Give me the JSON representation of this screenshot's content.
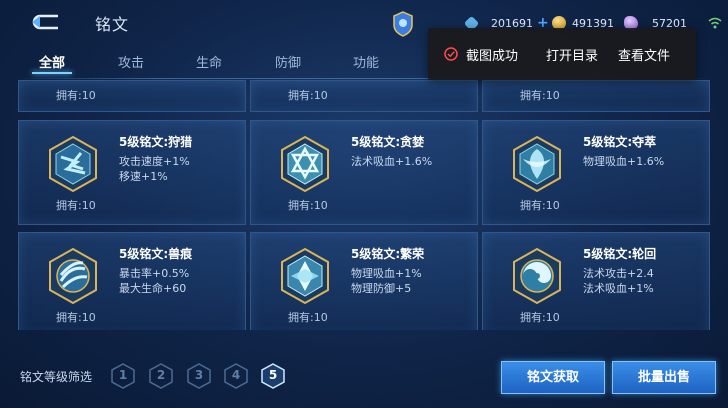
{
  "header": {
    "title": "铭文",
    "currencies": [
      {
        "icon": "coupon-gem-icon",
        "value": "201691",
        "color": "#5fb3e8"
      },
      {
        "icon": "gold-coin-icon",
        "value": "491391",
        "color": "#e0b24a"
      },
      {
        "icon": "purple-crystal-icon",
        "value": "57201",
        "color": "#b68cf0"
      }
    ]
  },
  "tabs": [
    "全部",
    "攻击",
    "生命",
    "防御",
    "功能"
  ],
  "active_tab": "全部",
  "toast": {
    "message": "截图成功",
    "open_dir": "打开目录",
    "view_file": "查看文件"
  },
  "cards_top": [
    {
      "owned": "拥有:10"
    },
    {
      "owned": "拥有:10"
    },
    {
      "owned": "拥有:10"
    }
  ],
  "cards": [
    {
      "name": "5级铭文:狩猎",
      "attr1": "攻击速度+1%",
      "attr2": "移速+1%",
      "owned": "拥有:10",
      "icon": "hunt-emblem-icon",
      "color": "#3fb6d8"
    },
    {
      "name": "5级铭文:贪婪",
      "attr1": "法术吸血+1.6%",
      "attr2": "",
      "owned": "拥有:10",
      "icon": "greed-emblem-icon",
      "color": "#5ed0e4"
    },
    {
      "name": "5级铭文:夺萃",
      "attr1": "物理吸血+1.6%",
      "attr2": "",
      "owned": "拥有:10",
      "icon": "plunder-emblem-icon",
      "color": "#48c0dc"
    },
    {
      "name": "5级铭文:兽痕",
      "attr1": "暴击率+0.5%",
      "attr2": "最大生命+60",
      "owned": "拥有:10",
      "icon": "beast-mark-emblem-icon",
      "color": "#4aa8d8"
    },
    {
      "name": "5级铭文:繁荣",
      "attr1": "物理吸血+1%",
      "attr2": "物理防御+5",
      "owned": "拥有:10",
      "icon": "prosperity-emblem-icon",
      "color": "#68c6e8"
    },
    {
      "name": "5级铭文:轮回",
      "attr1": "法术攻击+2.4",
      "attr2": "法术吸血+1%",
      "owned": "拥有:10",
      "icon": "samsara-emblem-icon",
      "color": "#4fb8e0"
    }
  ],
  "footer": {
    "filter_label": "铭文等级筛选",
    "levels": [
      "1",
      "2",
      "3",
      "4",
      "5"
    ],
    "active_level": "5",
    "obtain_button": "铭文获取",
    "sell_button": "批量出售"
  },
  "colors": {
    "accent": "#3a8ee8",
    "card_border": "#2f5789",
    "gold": "#d9b45a"
  }
}
